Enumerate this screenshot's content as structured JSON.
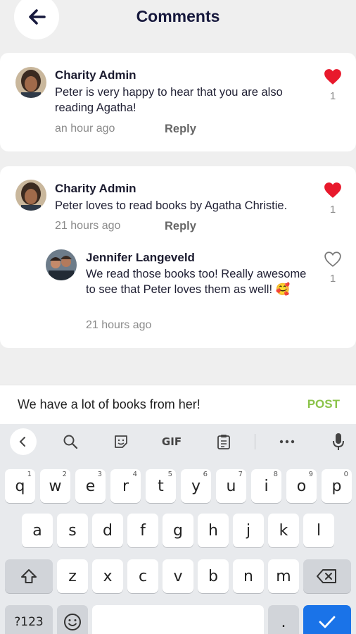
{
  "header": {
    "title": "Comments",
    "back_icon": "arrow-left-icon"
  },
  "comments": [
    {
      "author": "Charity Admin",
      "text": "Peter is very happy to hear that you are also reading Agatha!",
      "time": "an hour ago",
      "reply_label": "Reply",
      "likes": "1",
      "liked": true
    },
    {
      "author": "Charity Admin",
      "text": "Peter loves to read books by Agatha Christie.",
      "time": "21 hours ago",
      "reply_label": "Reply",
      "likes": "1",
      "liked": true
    }
  ],
  "reply": {
    "author": "Jennifer Langeveld",
    "text": "We read those books too! Really awesome to see that Peter loves them as well! 🥰",
    "time": "21 hours ago",
    "likes": "1",
    "liked": false
  },
  "compose": {
    "value": "We have a lot of books from her!",
    "post_label": "POST"
  },
  "keyboard": {
    "toolbar": {
      "gif_label": "GIF",
      "icons": [
        "chevron-left-icon",
        "search-icon",
        "sticker-icon",
        "gif-icon",
        "clipboard-icon",
        "more-icon",
        "microphone-icon"
      ]
    },
    "row1": [
      "q",
      "w",
      "e",
      "r",
      "t",
      "y",
      "u",
      "i",
      "o",
      "p"
    ],
    "row1_hints": [
      "1",
      "2",
      "3",
      "4",
      "5",
      "6",
      "7",
      "8",
      "9",
      "0"
    ],
    "row2": [
      "a",
      "s",
      "d",
      "f",
      "g",
      "h",
      "j",
      "k",
      "l"
    ],
    "row3": [
      "z",
      "x",
      "c",
      "v",
      "b",
      "n",
      "m"
    ],
    "symbols_label": "?123",
    "dot_label": "."
  },
  "colors": {
    "heart": "#e8192c",
    "post": "#8bc34a",
    "enter": "#1a73e8",
    "title": "#17193d"
  }
}
